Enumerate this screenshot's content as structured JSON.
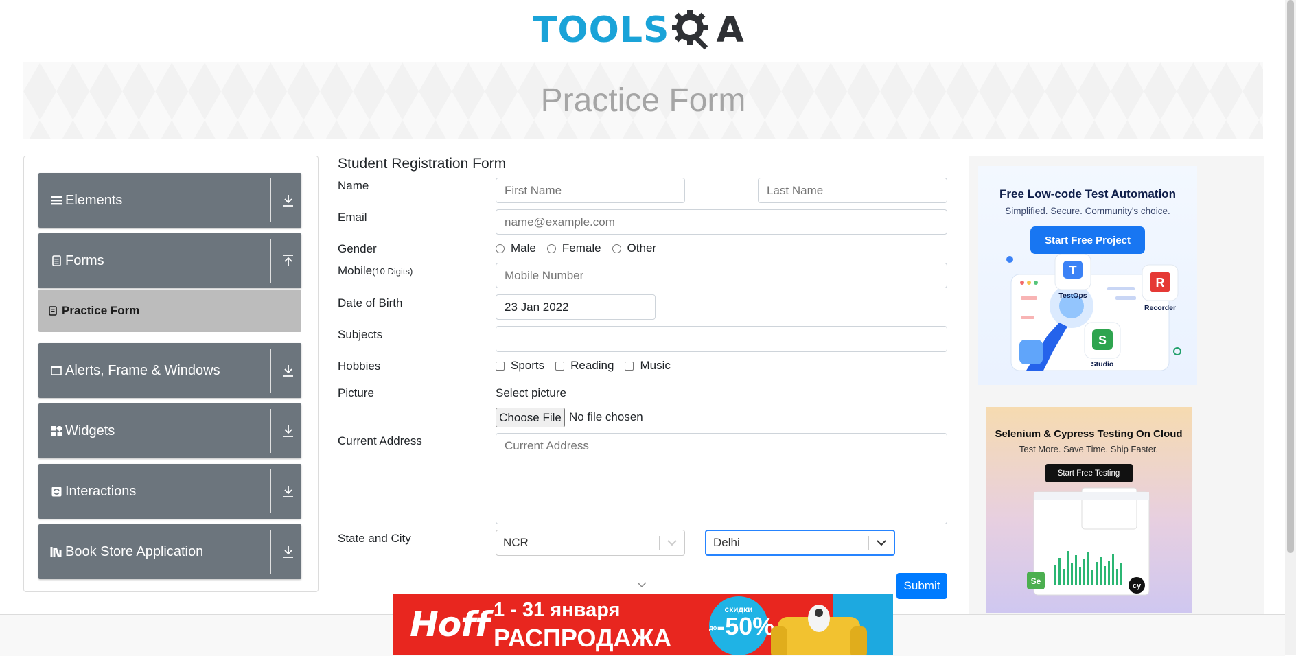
{
  "header": {
    "logo_tools": "TOOLS",
    "logo_a": "A"
  },
  "banner": {
    "title": "Practice Form"
  },
  "sidebar": {
    "groups": [
      {
        "label": "Elements",
        "icon": "list-icon",
        "expanded": false
      },
      {
        "label": "Forms",
        "icon": "document-icon",
        "expanded": true
      },
      {
        "label": "Alerts, Frame & Windows",
        "icon": "window-icon",
        "expanded": false
      },
      {
        "label": "Widgets",
        "icon": "grid-icon",
        "expanded": false
      },
      {
        "label": "Interactions",
        "icon": "interact-icon",
        "expanded": false
      },
      {
        "label": "Book Store Application",
        "icon": "books-icon",
        "expanded": false
      }
    ],
    "active_item": {
      "label": "Practice Form",
      "icon": "practice-form-icon"
    }
  },
  "form": {
    "title": "Student Registration Form",
    "labels": {
      "name": "Name",
      "email": "Email",
      "gender": "Gender",
      "mobile": "Mobile",
      "mobile_hint": "(10 Digits)",
      "dob": "Date of Birth",
      "subjects": "Subjects",
      "hobbies": "Hobbies",
      "picture": "Picture",
      "current_address": "Current Address",
      "state_city": "State and City"
    },
    "first_name_placeholder": "First Name",
    "last_name_placeholder": "Last Name",
    "email_placeholder": "name@example.com",
    "gender_options": [
      "Male",
      "Female",
      "Other"
    ],
    "mobile_placeholder": "Mobile Number",
    "dob_value": "23 Jan 2022",
    "subjects_value": "",
    "hobbies_options": [
      "Sports",
      "Reading",
      "Music"
    ],
    "select_picture_label": "Select picture",
    "choose_file_label": "Choose File",
    "no_file_text": "No file chosen",
    "current_address_placeholder": "Current Address",
    "state_value": "NCR",
    "city_value": "Delhi",
    "submit_label": "Submit"
  },
  "ads": {
    "katalon": {
      "headline": "Free Low-code Test Automation",
      "subline": "Simplified. Secure. Community's choice.",
      "button": "Start Free Project",
      "tiles": [
        "TestOps",
        "Recorder",
        "Studio"
      ]
    },
    "cloud": {
      "headline": "Selenium & Cypress Testing On Cloud",
      "subline": "Test More. Save Time. Ship Faster.",
      "button": "Start Free Testing"
    },
    "hoff": {
      "brand": "Hoff",
      "line1": "1 - 31 января",
      "line2": "РАСПРОДАЖА",
      "badge_top": "скидки",
      "badge_prefix": "до",
      "badge_value": "-50%"
    }
  },
  "colors": {
    "sidebar_group_bg": "#6c757d",
    "active_item_bg": "#bcbcbc",
    "primary": "#007bff",
    "logo_blue": "#1aa3d8",
    "hoff_red": "#e8261f"
  }
}
